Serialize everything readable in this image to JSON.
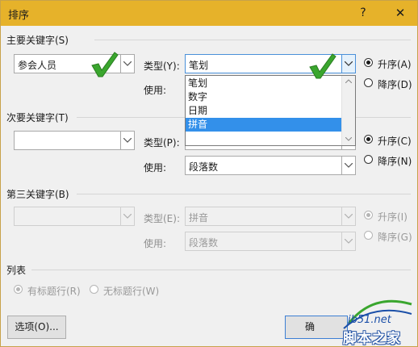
{
  "window": {
    "title": "排序",
    "help": "?",
    "close": "✕"
  },
  "primary": {
    "group_label": "主要关键字(S)",
    "key_value": "参会人员",
    "type_label": "类型(Y):",
    "type_value": "笔划",
    "use_label": "使用:",
    "asc": "升序(A)",
    "desc": "降序(D)",
    "order_selected": "asc",
    "dropdown_options": [
      "笔划",
      "数字",
      "日期",
      "拼音"
    ],
    "dropdown_selected": "拼音"
  },
  "secondary": {
    "group_label": "次要关键字(T)",
    "key_value": "",
    "type_label": "类型(P):",
    "use_label": "使用:",
    "use_value": "段落数",
    "asc": "升序(C)",
    "desc": "降序(N)",
    "order_selected": "asc"
  },
  "third": {
    "group_label": "第三关键字(B)",
    "key_value": "",
    "type_label": "类型(E):",
    "type_value": "拼音",
    "use_label": "使用:",
    "use_value": "段落数",
    "asc": "升序(I)",
    "desc": "降序(G)",
    "order_selected": "asc"
  },
  "list": {
    "group_label": "列表",
    "has_header": "有标题行(R)",
    "no_header": "无标题行(W)",
    "selected": "has_header"
  },
  "buttons": {
    "options": "选项(O)...",
    "ok_partial": "确"
  },
  "watermark": {
    "site": "jb51.net",
    "name": "脚本之家"
  },
  "colors": {
    "titlebar": "#e6b22a",
    "selection": "#3390ea",
    "check": "#3aa62e"
  }
}
